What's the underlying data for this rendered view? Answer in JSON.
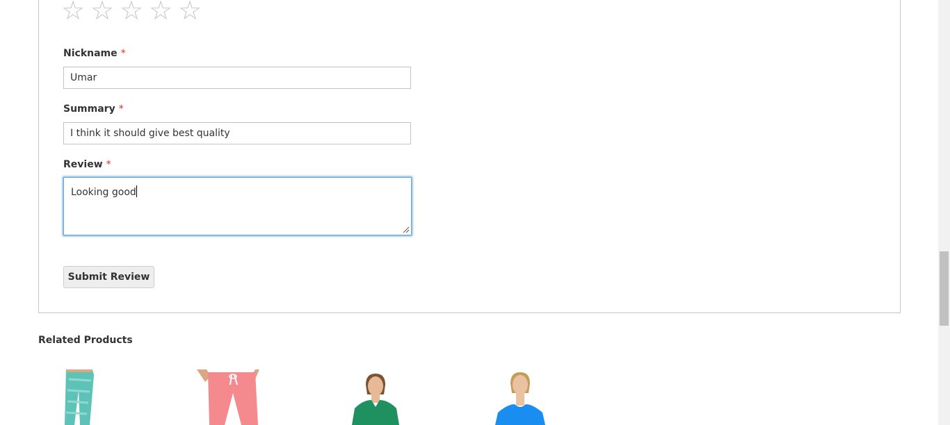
{
  "review_form": {
    "rating_stars": [
      "☆",
      "☆",
      "☆",
      "☆",
      "☆"
    ],
    "nickname": {
      "label": "Nickname",
      "required_mark": "*",
      "value": "Umar"
    },
    "summary": {
      "label": "Summary",
      "required_mark": "*",
      "value": "I think it should give best quality"
    },
    "review": {
      "label": "Review",
      "required_mark": "*",
      "value": "Looking good"
    },
    "submit_label": "Submit Review"
  },
  "related_products": {
    "title": "Related Products",
    "items": [
      {
        "icon": "teal-leggings-product-image"
      },
      {
        "icon": "pink-pants-product-image"
      },
      {
        "icon": "green-scoop-tee-product-image"
      },
      {
        "icon": "blue-tee-product-image"
      }
    ]
  },
  "colors": {
    "required": "#e02b27",
    "focus_border": "#6aa6c9",
    "star": "#c7c7c7"
  }
}
